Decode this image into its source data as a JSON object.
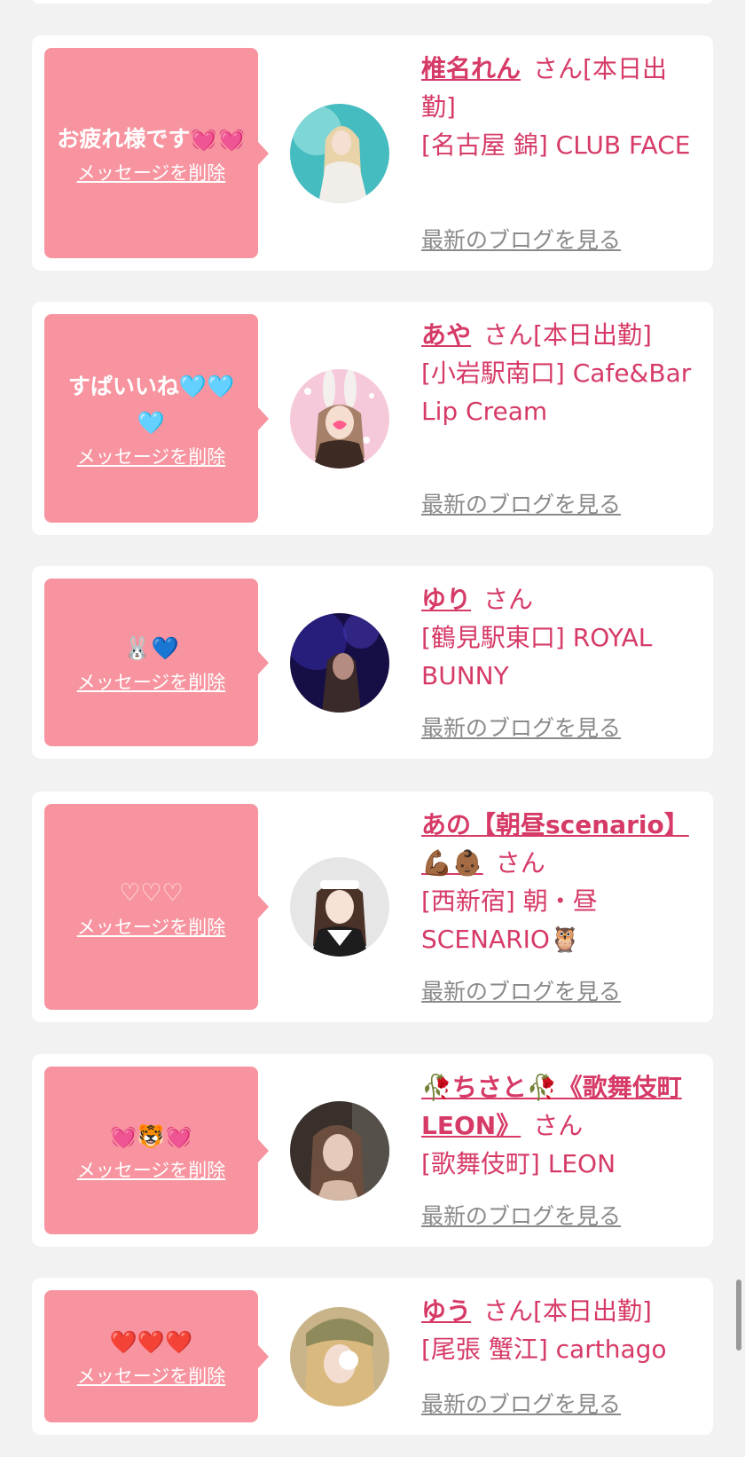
{
  "cards": [
    {
      "message": "お疲れ様です💓💓",
      "delete_label": "メッセージを削除",
      "name": "椎名れん",
      "suffix": "さん[本日出勤]",
      "shop": "[名古屋 錦] CLUB FACE",
      "blog_label": "最新のブログを見る",
      "avatar_colors": [
        "#7fd6d6",
        "#3fb0b5",
        "#f4e9e2"
      ]
    },
    {
      "message": "すぱいいね🩵🩵🩵",
      "delete_label": "メッセージを削除",
      "name": "あや",
      "suffix": "さん[本日出勤]",
      "shop": "[小岩駅南口] Cafe&Bar Lip Cream",
      "blog_label": "最新のブログを見る",
      "avatar_colors": [
        "#f7c6d9",
        "#e8a3b8",
        "#6b4a3a"
      ]
    },
    {
      "message": "🐰💙",
      "delete_label": "メッセージを削除",
      "name": "ゆり",
      "suffix": "さん",
      "shop": "[鶴見駅東口] ROYAL BUNNY",
      "blog_label": "最新のブログを見る",
      "avatar_colors": [
        "#3b2fa0",
        "#120d3a",
        "#c99a8a"
      ]
    },
    {
      "message": "♡♡♡",
      "delete_label": "メッセージを削除",
      "name": "あの【朝昼scenario】💪🏾👶🏾",
      "suffix": "さん",
      "shop": "[西新宿] 朝・昼SCENARIO🦉",
      "blog_label": "最新のブログを見る",
      "avatar_colors": [
        "#eaeaea",
        "#d8d8d8",
        "#5a4033"
      ]
    },
    {
      "message": "💓🐯💓",
      "delete_label": "メッセージを削除",
      "name": "🥀ちさと🥀《歌舞伎町LEON》",
      "suffix": "さん",
      "shop": "[歌舞伎町] LEON",
      "blog_label": "最新のブログを見る",
      "avatar_colors": [
        "#5a4a42",
        "#2b2522",
        "#d8bfae"
      ]
    },
    {
      "message": "❤️❤️❤️",
      "delete_label": "メッセージを削除",
      "name": "ゆう",
      "suffix": "さん[本日出勤]",
      "shop": "[尾張 蟹江] carthago",
      "blog_label": "最新のブログを見る",
      "avatar_colors": [
        "#9a9a68",
        "#d9c09a",
        "#fff4f4"
      ]
    }
  ]
}
